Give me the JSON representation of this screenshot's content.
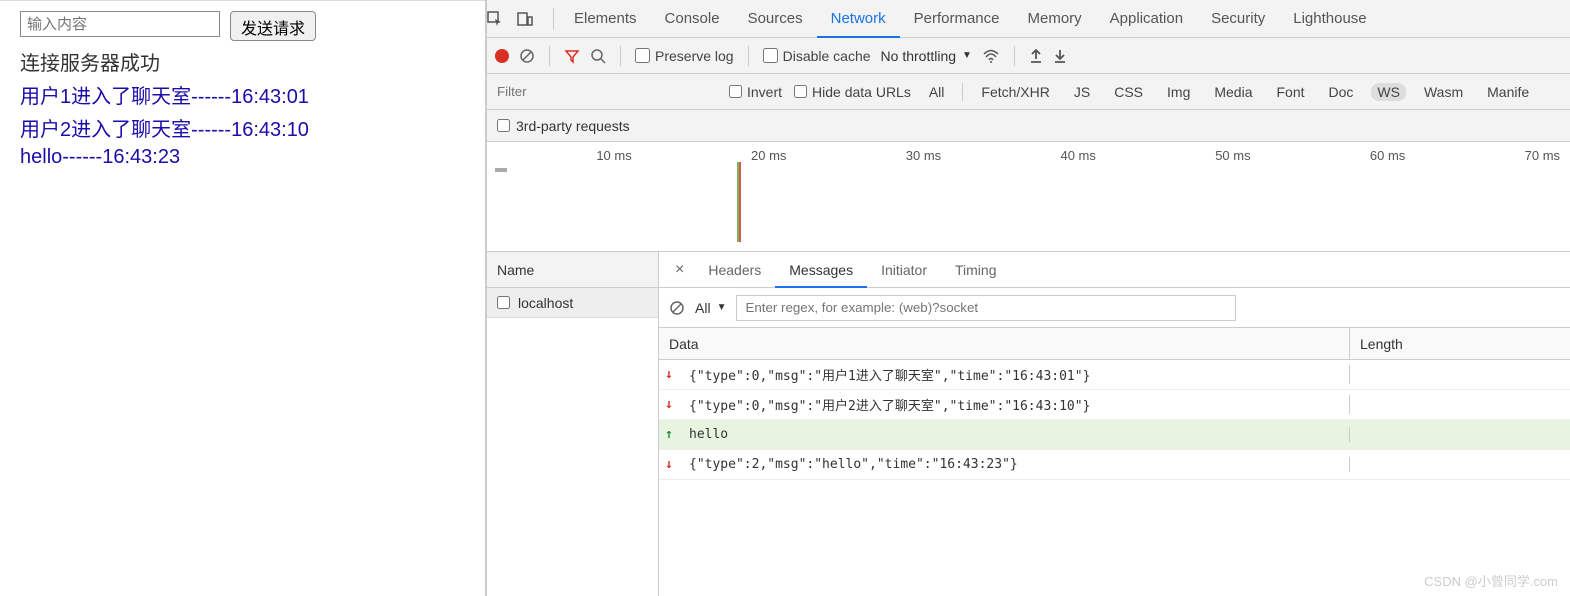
{
  "left": {
    "input_placeholder": "输入内容",
    "send_btn": "发送请求",
    "status": "连接服务器成功",
    "messages": [
      "用户1进入了聊天室------16:43:01",
      "用户2进入了聊天室------16:43:10",
      "hello------16:43:23"
    ]
  },
  "devtools": {
    "tabs": [
      "Elements",
      "Console",
      "Sources",
      "Network",
      "Performance",
      "Memory",
      "Application",
      "Security",
      "Lighthouse"
    ],
    "active_tab": "Network",
    "toolbar": {
      "preserve_log": "Preserve log",
      "disable_cache": "Disable cache",
      "throttling": "No throttling"
    },
    "filter": {
      "placeholder": "Filter",
      "invert": "Invert",
      "hide_data": "Hide data URLs",
      "types": [
        "All",
        "Fetch/XHR",
        "JS",
        "CSS",
        "Img",
        "Media",
        "Font",
        "Doc",
        "WS",
        "Wasm",
        "Manife"
      ],
      "active_type": "WS",
      "third_party": "3rd-party requests"
    },
    "timeline_ticks": [
      "10 ms",
      "20 ms",
      "30 ms",
      "40 ms",
      "50 ms",
      "60 ms",
      "70 ms"
    ],
    "name_header": "Name",
    "name_items": [
      "localhost"
    ],
    "detail_tabs": [
      "Headers",
      "Messages",
      "Initiator",
      "Timing"
    ],
    "detail_active": "Messages",
    "msg_filter": {
      "all": "All",
      "regex_placeholder": "Enter regex, for example: (web)?socket"
    },
    "msg_headers": {
      "data": "Data",
      "length": "Length"
    },
    "ws_messages": [
      {
        "dir": "down",
        "text": "{\"type\":0,\"msg\":\"用户1进入了聊天室\",\"time\":\"16:43:01\"}"
      },
      {
        "dir": "down",
        "text": "{\"type\":0,\"msg\":\"用户2进入了聊天室\",\"time\":\"16:43:10\"}"
      },
      {
        "dir": "up",
        "text": "hello"
      },
      {
        "dir": "down",
        "text": "{\"type\":2,\"msg\":\"hello\",\"time\":\"16:43:23\"}"
      }
    ]
  },
  "watermark": "CSDN @小曾同学.com"
}
